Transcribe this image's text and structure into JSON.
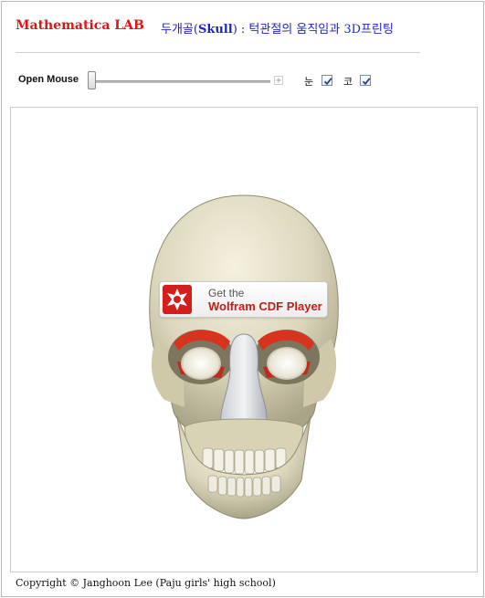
{
  "header": {
    "brand": "Mathematica LAB",
    "title_prefix": "두개골(",
    "title_bold": "Skull",
    "title_suffix": ") : 턱관절의 움직임과 3D프린팅"
  },
  "controls": {
    "slider_label": "Open Mouse",
    "slider_value": 0,
    "plus_symbol": "+",
    "eye_label": "눈",
    "eye_checked": true,
    "nose_label": "코",
    "nose_checked": true
  },
  "overlay": {
    "get_text": "Get the",
    "product_text": "Wolfram CDF Player"
  },
  "footer": {
    "copyright": "Copyright © Janghoon Lee (Paju girls' high school)"
  },
  "colors": {
    "brand": "#e01414",
    "title": "#1e24c8",
    "cdf_red": "#d21f1b"
  }
}
